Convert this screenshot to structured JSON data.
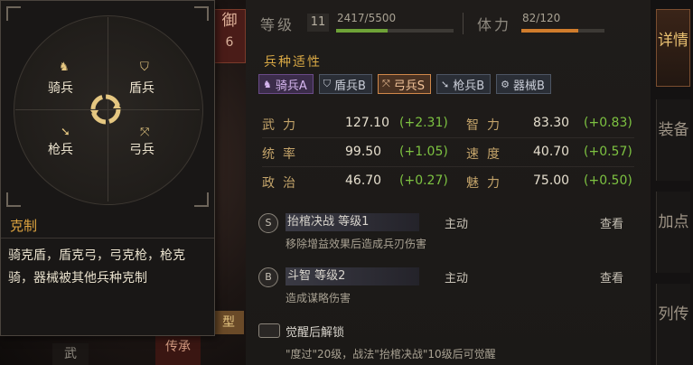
{
  "header": {
    "level_label": "等级",
    "level_value": "11",
    "exp_text": "2417/5500",
    "exp_progress": 0.44,
    "stamina_label": "体力",
    "stamina_text": "82/120",
    "stamina_progress": 0.68
  },
  "side_badge": {
    "label": "御",
    "value": "6"
  },
  "aptitude": {
    "title": "兵种适性",
    "items": [
      {
        "label": "骑兵A",
        "icon": "horse-icon"
      },
      {
        "label": "盾兵B",
        "icon": "shield-icon"
      },
      {
        "label": "弓兵S",
        "icon": "bow-icon"
      },
      {
        "label": "枪兵B",
        "icon": "spear-icon"
      },
      {
        "label": "器械B",
        "icon": "siege-icon"
      }
    ]
  },
  "stats": [
    {
      "name": "武力",
      "value": "127.10",
      "bonus": "(+2.31)"
    },
    {
      "name": "智力",
      "value": "83.30",
      "bonus": "(+0.83)"
    },
    {
      "name": "统率",
      "value": "99.50",
      "bonus": "(+1.05)"
    },
    {
      "name": "速度",
      "value": "40.70",
      "bonus": "(+0.57)"
    },
    {
      "name": "政治",
      "value": "46.70",
      "bonus": "(+0.27)"
    },
    {
      "name": "魅力",
      "value": "75.00",
      "bonus": "(+0.50)"
    }
  ],
  "skills": [
    {
      "badge": "S",
      "name": "抬棺决战 等级1",
      "type": "主动",
      "view": "查看",
      "desc": "移除增益效果后造成兵刃伤害"
    },
    {
      "badge": "B",
      "name": "斗智 等级2",
      "type": "主动",
      "view": "查看",
      "desc": "造成谋略伤害"
    }
  ],
  "awaken": {
    "name": "觉醒后解锁",
    "desc": "\"度过\"20级，战法\"抬棺决战\"10级后可觉醒"
  },
  "tabs": [
    {
      "label": "详情",
      "active": true
    },
    {
      "label": "装备",
      "active": false
    },
    {
      "label": "加点",
      "active": false
    },
    {
      "label": "列传",
      "active": false
    }
  ],
  "popup": {
    "wheel": {
      "top_left": "骑兵",
      "top_right": "盾兵",
      "bottom_left": "枪兵",
      "bottom_right": "弓兵"
    },
    "title": "克制",
    "body": "骑克盾，盾克弓，弓克枪，枪克骑，器械被其他兵种克制"
  },
  "bottom": {
    "left_tab": "武",
    "seal": "传承",
    "xing": "型"
  }
}
